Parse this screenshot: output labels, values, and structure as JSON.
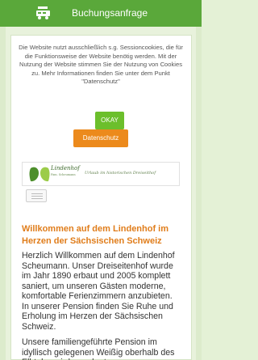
{
  "topbar": {
    "icon": "bus-icon",
    "label": "Buchungsanfrage"
  },
  "cookie_notice": {
    "text": "Die Website nutzt ausschließlich s.g. Sessioncookies, die für die Funktionsweise der Website benötig werden. Mit der Nutzung der Website stimmen Sie der Nutzung von Cookies zu. Mehr Informationen finden Sie unter dem Punkt \"Datenschutz\"",
    "okay_label": "OKAY",
    "privacy_label": "Datenschutz"
  },
  "header": {
    "brand": "Lindenhof",
    "brand_sub": "Fam. Scheumann",
    "tagline": "Urlaub im historischen Dreiseithof",
    "menu_icon": "hamburger-icon"
  },
  "content": {
    "headline": "Willkommen auf dem Lindenhof im Herzen der Sächsischen Schweiz",
    "paragraph_1": "Herzlich Willkommen auf dem Lindenhof Scheumann. Unser Dreiseitenhof wurde im Jahr 1890 erbaut und 2005 komplett saniert, um unseren Gästen moderne, komfortable Ferienzimmern anzubieten. In unserer Pension finden Sie Ruhe und Erholung im Herzen der Sächsischen Schweiz.",
    "paragraph_2": "Unsere familiengeführte Pension im idyllisch gelegenen Weißig oberhalb des Elbtales wird umrahmt von"
  },
  "colors": {
    "topbar": "#5aa83a",
    "okay": "#6cbf2c",
    "privacy": "#ec8a1c",
    "headline": "#e07d1b"
  }
}
